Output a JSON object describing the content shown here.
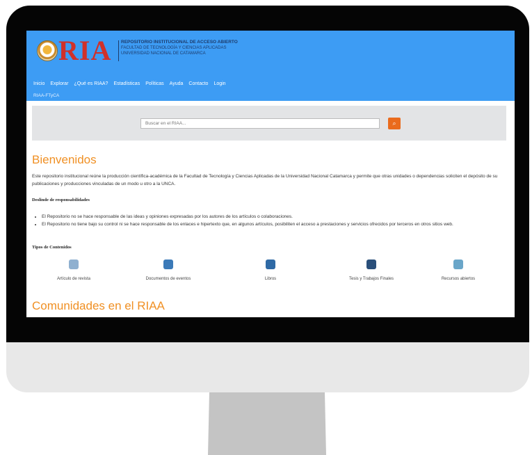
{
  "header": {
    "logo_text": "RIA",
    "logo_sub": [
      "REPOSITORIO INSTITUCIONAL DE ACCESO ABIERTO",
      "FACULTAD DE TECNOLOGÍA Y CIENCIAS APLICADAS",
      "UNIVERSIDAD NACIONAL DE CATAMARCA"
    ],
    "nav": [
      "Inicio",
      "Explorar",
      "¿Qué es RIAA?",
      "Estadísticas",
      "Políticas",
      "Ayuda",
      "Contacto",
      "Login"
    ],
    "breadcrumb": "RIAA-FTyCA"
  },
  "search": {
    "placeholder": "Buscar en el RIAA..."
  },
  "welcome": {
    "title": "Bienvenidos",
    "text": "Este repositorio institucional reúne la producción científica-académica de la Facultad de Tecnología y Ciencias Aplicadas de la Universidad Nacional Catamarca y permite que otras unidades o dependencias soliciten el depósito de su publicaciones y producciones vinculadas de un modo u otro a la UNCA."
  },
  "disclaimer": {
    "title": "Deslinde de responsabilidades",
    "items": [
      "El Repositorio no se hace responsable de las ideas y opiniones expresadas por los autores de los artículos o colaboraciones.",
      "El Repositorio no tiene bajo su control ni se hace responsable de los enlaces e hipertexto que, en algunos artículos, posibiliten el acceso a prestaciones y servicios ofrecidos por terceros en otros sitios web."
    ]
  },
  "content_types": {
    "title": "Tipos de Contenidos",
    "items": [
      {
        "label": "Artículo de revista",
        "icon": "journal-icon",
        "color": "#6d8fb0"
      },
      {
        "label": "Documentos de eventos",
        "icon": "event-document-icon",
        "color": "#3b7ab8"
      },
      {
        "label": "Libros",
        "icon": "book-icon",
        "color": "#2f6aa5"
      },
      {
        "label": "Tesis y Trabajos Finales",
        "icon": "thesis-icon",
        "color": "#2a4f7a"
      },
      {
        "label": "Recursos abiertos",
        "icon": "open-resource-icon",
        "color": "#6aa6c9"
      }
    ]
  },
  "communities": {
    "title": "Comunidades en el RIAA"
  },
  "colors": {
    "header": "#3d9cf4",
    "accent": "#f09024",
    "search_button": "#ea6b1d"
  }
}
